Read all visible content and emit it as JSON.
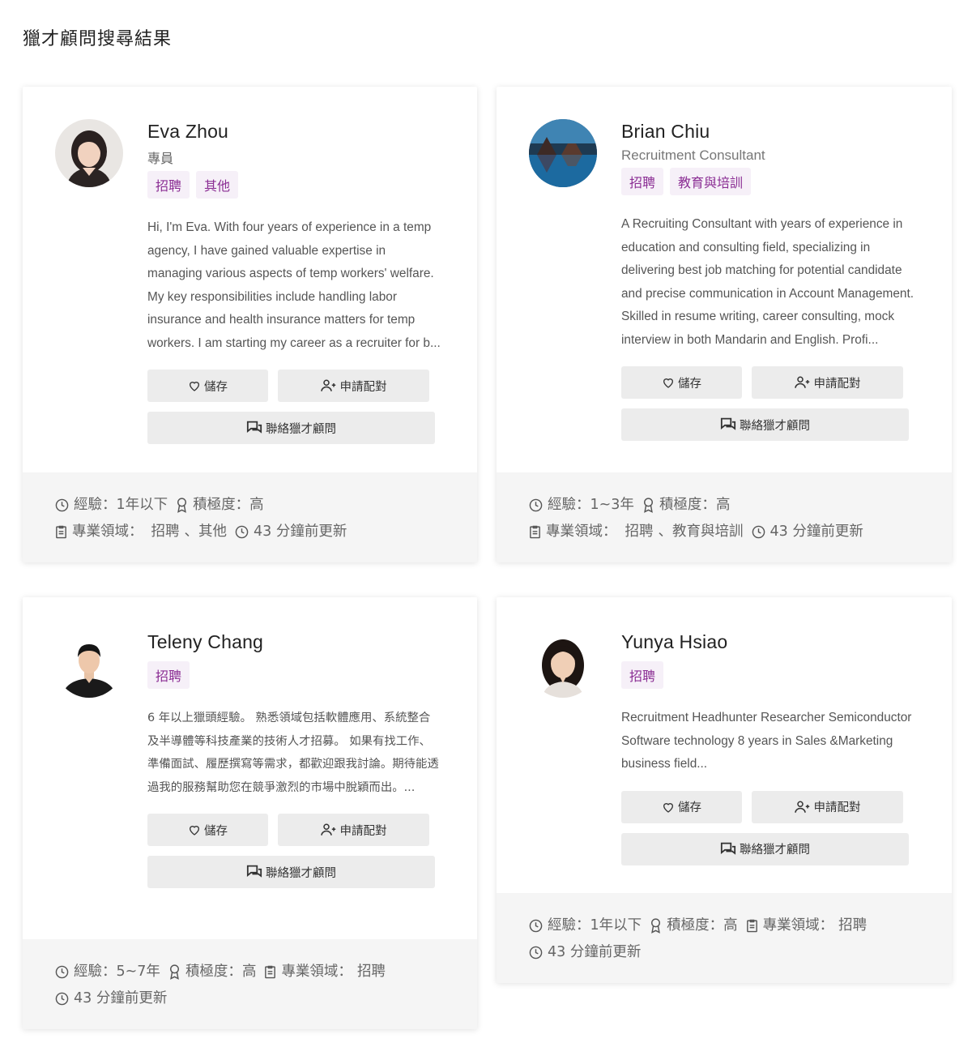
{
  "page": {
    "title": "獵才顧問搜尋結果"
  },
  "labels": {
    "save": "儲存",
    "match": "申請配對",
    "contact": "聯絡獵才顧問",
    "experience_prefix": "經驗：",
    "activity_prefix": "積極度：",
    "field_prefix": "專業領域：",
    "tag_sep": "、",
    "updated": "43 分鐘前更新"
  },
  "consultants": [
    {
      "name": "Eva Zhou",
      "role": "專員",
      "tags": [
        "招聘",
        "其他"
      ],
      "bio": "Hi, I'm Eva. With four years of experience in a temp agency, I have gained valuable expertise in managing various aspects of temp workers' welfare. My key responsibilities include handling labor insurance and health insurance matters for temp workers. I am starting my career as a recruiter for b...",
      "experience": "1年以下",
      "activity": "高",
      "fields": [
        "招聘",
        "其他"
      ]
    },
    {
      "name": "Brian Chiu",
      "role": "Recruitment Consultant",
      "tags": [
        "招聘",
        "教育與培訓"
      ],
      "bio": "A Recruiting Consultant with years of experience in education and consulting field, specializing in delivering best job matching for potential candidate and precise communication in Account Management. Skilled in resume writing, career consulting, mock interview in both Mandarin and English. Profi...",
      "experience": "1~3年",
      "activity": "高",
      "fields": [
        "招聘",
        "教育與培訓"
      ]
    },
    {
      "name": "Teleny Chang",
      "role": "",
      "tags": [
        "招聘"
      ],
      "bio": "6 年以上獵頭經驗。 熟悉領域包括軟體應用、系統整合及半導體等科技產業的技術人才招募。 如果有找工作、準備面試、履歷撰寫等需求，都歡迎跟我討論。期待能透過我的服務幫助您在競爭激烈的市場中脫穎而出。...",
      "experience": "5~7年",
      "activity": "高",
      "fields": [
        "招聘"
      ]
    },
    {
      "name": "Yunya Hsiao",
      "role": "",
      "tags": [
        "招聘"
      ],
      "bio": "Recruitment Headhunter Researcher Semiconductor Software technology 8 years in Sales &Marketing business field...",
      "experience": "1年以下",
      "activity": "高",
      "fields": [
        "招聘"
      ]
    }
  ],
  "colors": {
    "tag_bg": "#f6f0f8",
    "tag_text": "#8b2e94",
    "button_bg": "#ececec",
    "footer_bg": "#f5f5f5"
  },
  "icons": [
    "heart-icon",
    "user-plus-icon",
    "chat-icon",
    "clock-icon",
    "award-icon",
    "clipboard-icon"
  ]
}
